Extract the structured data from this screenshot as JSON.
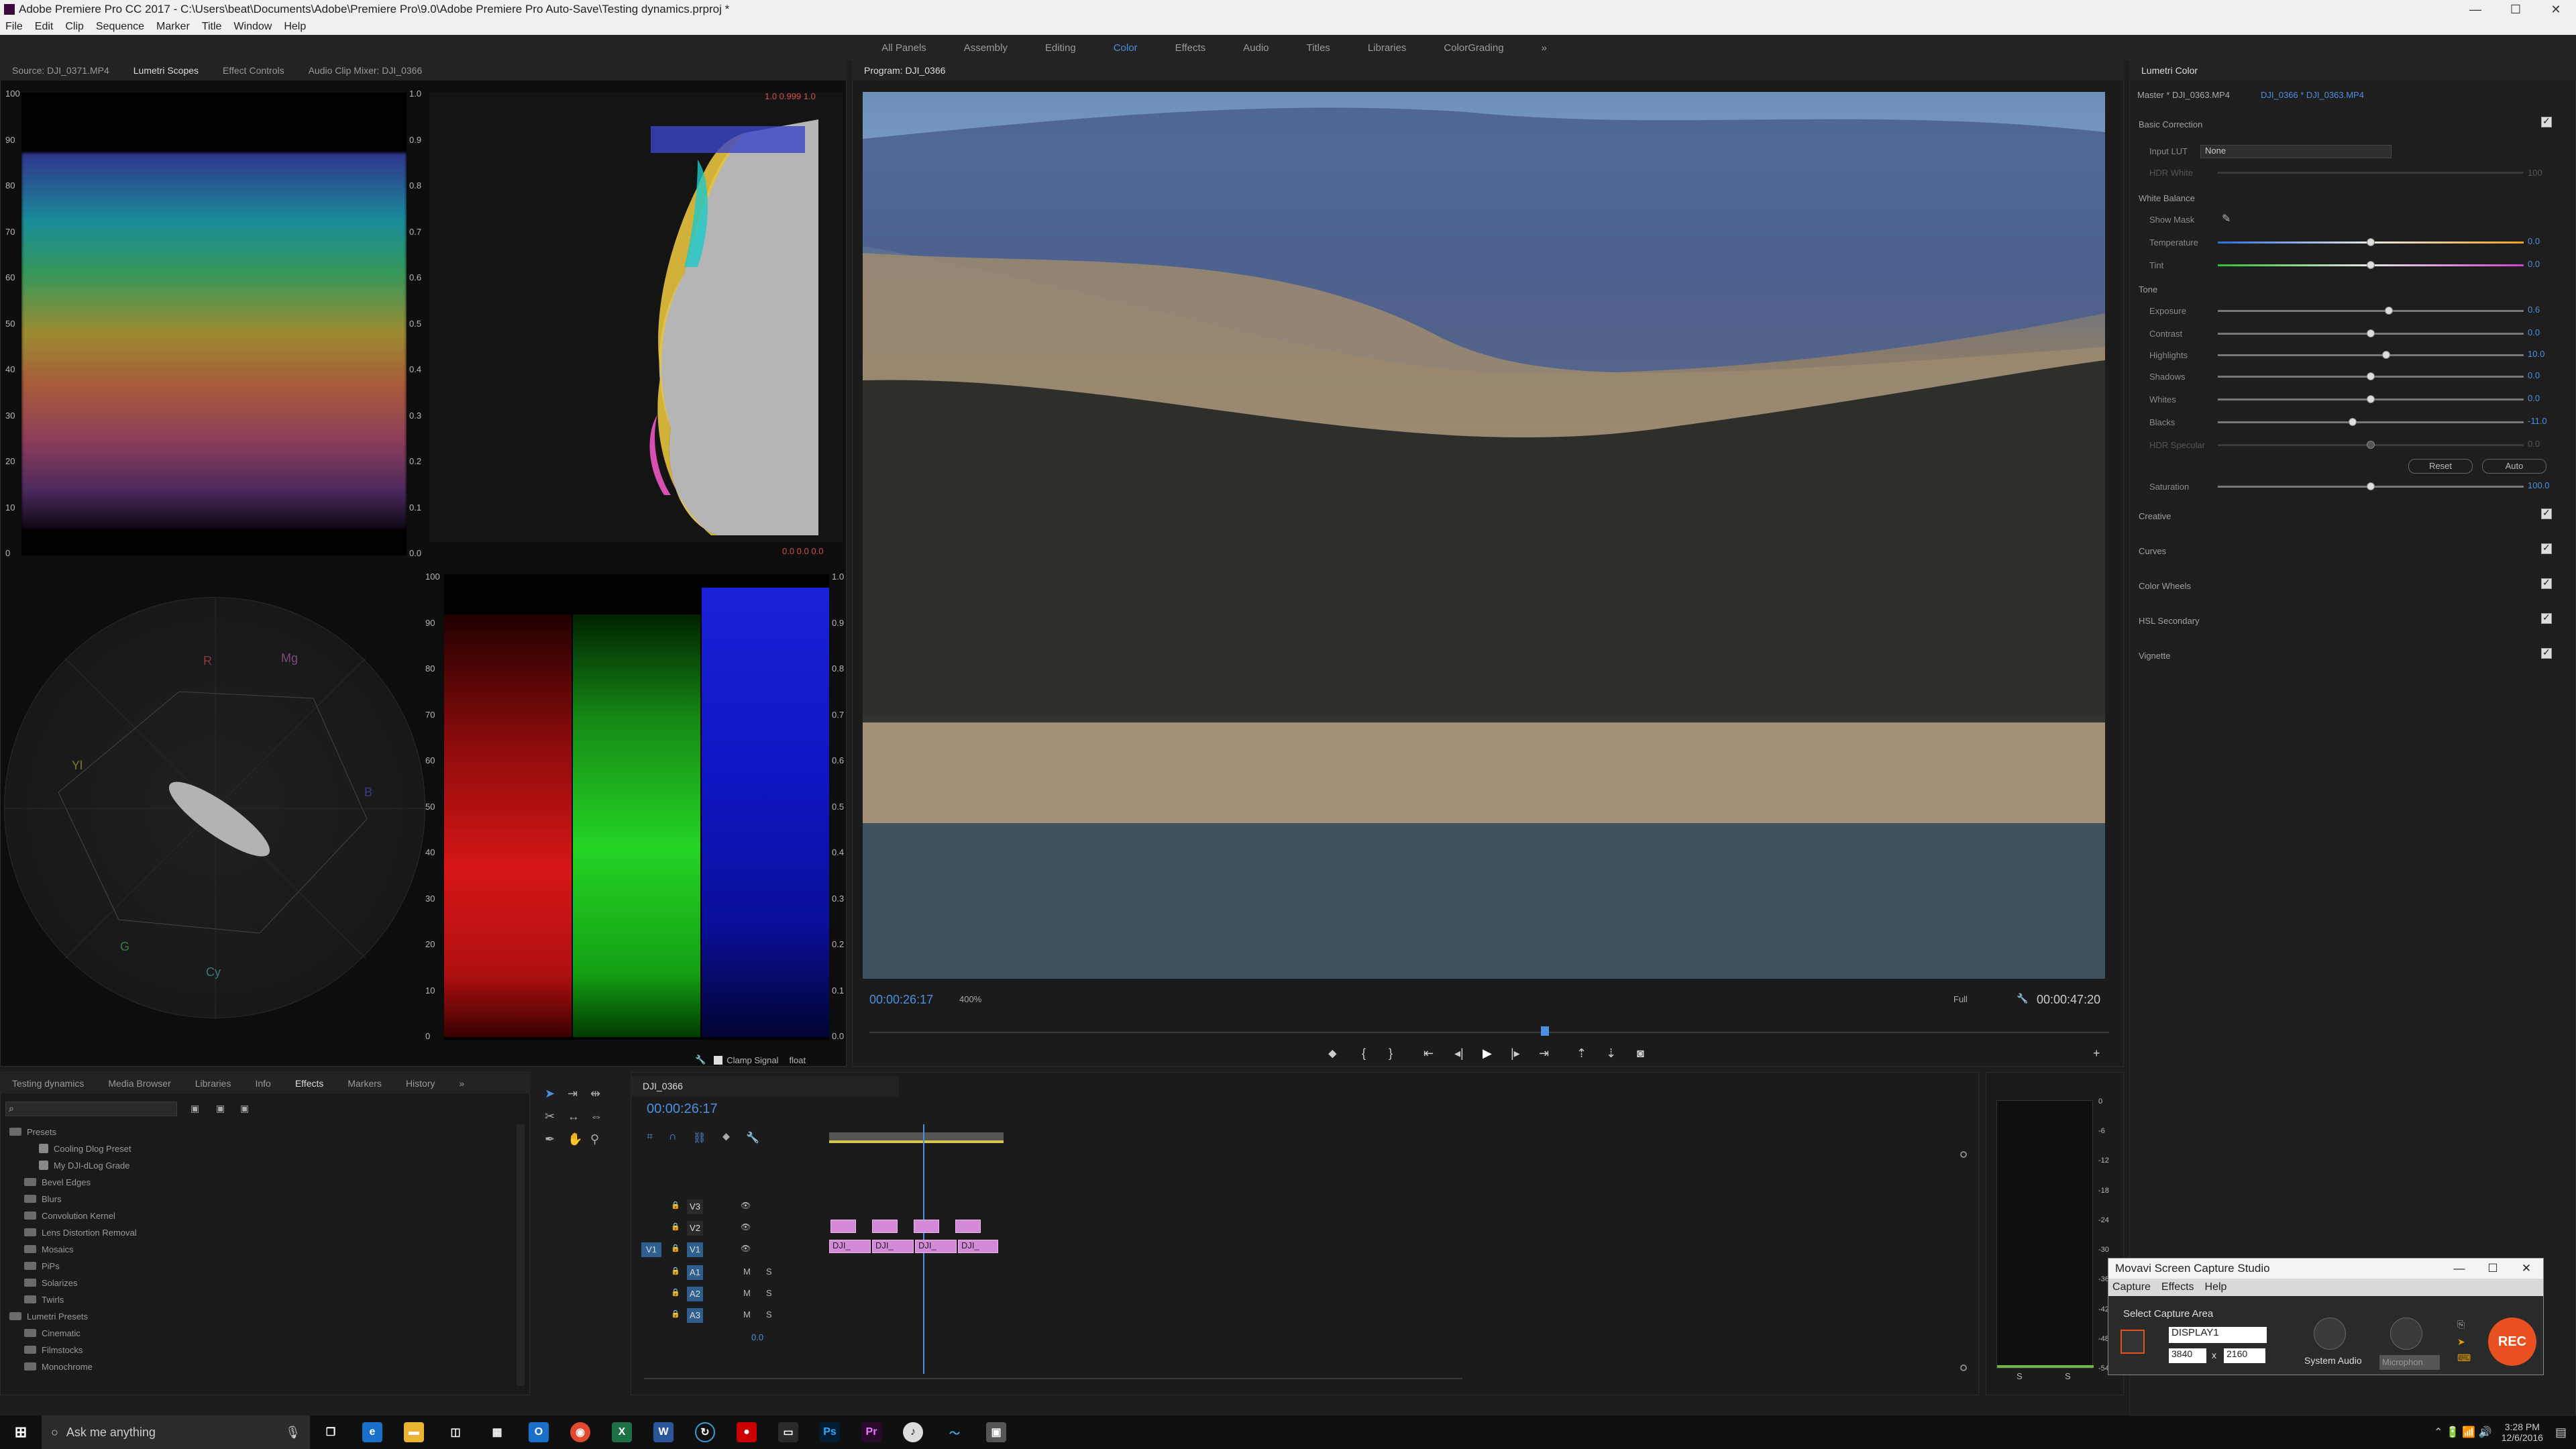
{
  "window": {
    "title": "Adobe Premiere Pro CC 2017 - C:\\Users\\beat\\Documents\\Adobe\\Premiere Pro\\9.0\\Adobe Premiere Pro Auto-Save\\Testing dynamics.prproj *",
    "minimize": "—",
    "maximize": "☐",
    "close": "✕"
  },
  "menu": [
    "File",
    "Edit",
    "Clip",
    "Sequence",
    "Marker",
    "Title",
    "Window",
    "Help"
  ],
  "workspaces": [
    "All Panels",
    "Assembly",
    "Editing",
    "Color",
    "Effects",
    "Audio",
    "Titles",
    "Libraries",
    "ColorGrading"
  ],
  "workspace_more": "»",
  "source_panel": {
    "tabs": [
      "Source: DJI_0371.MP4",
      "Lumetri Scopes",
      "Effect Controls",
      "Audio Clip Mixer: DJI_0366"
    ],
    "active": "Lumetri Scopes",
    "waveform_left_ticks": [
      "100",
      "90",
      "80",
      "70",
      "60",
      "50",
      "40",
      "30",
      "20",
      "10",
      "0"
    ],
    "waveform_right_ticks": [
      "1.0",
      "0.9",
      "0.8",
      "0.7",
      "0.6",
      "0.5",
      "0.4",
      "0.3",
      "0.2",
      "0.1",
      "0.0"
    ],
    "histogram_top_readout": "1.0  0.999  1.0",
    "histogram_bottom_readout": "0.0  0.0  0.0",
    "vectorscope_labels": [
      "R",
      "Mg",
      "B",
      "Cy",
      "G",
      "Yl"
    ],
    "rgb_parade_ticks_left": [
      "100",
      "90",
      "80",
      "70",
      "60",
      "50",
      "40",
      "30",
      "20",
      "10",
      "0"
    ],
    "rgb_parade_ticks_right": [
      "1.0",
      "0.9",
      "0.8",
      "0.7",
      "0.6",
      "0.5",
      "0.4",
      "0.3",
      "0.2",
      "0.1",
      "0.0"
    ],
    "clamp_signal": "Clamp Signal",
    "float_select": "float"
  },
  "program": {
    "title": "Program: DJI_0366",
    "timecode_current": "00:00:26:17",
    "zoom": "400%",
    "quality": "Full",
    "timecode_total": "00:00:47:20",
    "playhead": 0.545
  },
  "lumetri": {
    "title": "Lumetri Color",
    "master": "Master * DJI_0363.MP4",
    "clip": "DJI_0366 * DJI_0363.MP4",
    "basic_correction": "Basic Correction",
    "input_lut_label": "Input LUT",
    "input_lut_value": "None",
    "hdr_white": "HDR White",
    "hdr_white_val": "100",
    "white_balance": "White Balance",
    "show_mask": "Show Mask",
    "sliders": [
      {
        "label": "Temperature",
        "value": "0.0",
        "pos": 0.5
      },
      {
        "label": "Tint",
        "value": "0.0",
        "pos": 0.5
      },
      {
        "label": "Exposure",
        "value": "0.6",
        "pos": 0.56
      },
      {
        "label": "Contrast",
        "value": "0.0",
        "pos": 0.5
      },
      {
        "label": "Highlights",
        "value": "10.0",
        "pos": 0.55
      },
      {
        "label": "Shadows",
        "value": "0.0",
        "pos": 0.5
      },
      {
        "label": "Whites",
        "value": "0.0",
        "pos": 0.5
      },
      {
        "label": "Blacks",
        "value": "-11.0",
        "pos": 0.44
      },
      {
        "label": "HDR Specular",
        "value": "0.0",
        "pos": 0.5
      }
    ],
    "tone": "Tone",
    "reset": "Reset",
    "auto": "Auto",
    "saturation": "Saturation",
    "saturation_value": "100.0",
    "saturation_pos": 0.5,
    "sections": [
      "Creative",
      "Curves",
      "Color Wheels",
      "HSL Secondary",
      "Vignette"
    ]
  },
  "project_panel": {
    "tabs": [
      "Testing dynamics",
      "Media Browser",
      "Libraries",
      "Info",
      "Effects",
      "Markers",
      "History"
    ],
    "active": "Effects",
    "more": "»",
    "tree": [
      {
        "label": "Presets",
        "indent": 0
      },
      {
        "label": "Cooling Dlog Preset",
        "indent": 2
      },
      {
        "label": "My DJI-dLog Grade",
        "indent": 2
      },
      {
        "label": "Bevel Edges",
        "indent": 1
      },
      {
        "label": "Blurs",
        "indent": 1
      },
      {
        "label": "Convolution Kernel",
        "indent": 1
      },
      {
        "label": "Lens Distortion Removal",
        "indent": 1
      },
      {
        "label": "Mosaics",
        "indent": 1
      },
      {
        "label": "PiPs",
        "indent": 1
      },
      {
        "label": "Solarizes",
        "indent": 1
      },
      {
        "label": "Twirls",
        "indent": 1
      },
      {
        "label": "Lumetri Presets",
        "indent": 0
      },
      {
        "label": "Cinematic",
        "indent": 1
      },
      {
        "label": "Filmstocks",
        "indent": 1
      },
      {
        "label": "Monochrome",
        "indent": 1
      }
    ]
  },
  "timeline": {
    "tab": "DJI_0366",
    "timecode": "00:00:26:17",
    "tracks_video": [
      "V3",
      "V2",
      "V1"
    ],
    "tracks_audio": [
      "A1",
      "A2",
      "A3"
    ],
    "source_patch": "V1",
    "master_value": "0.0",
    "clip_labels": [
      "DJI_",
      "DJI_",
      "DJI_",
      "DJI_"
    ],
    "m": "M",
    "s": "S"
  },
  "meter": {
    "ticks": [
      "0",
      "-6",
      "-12",
      "-18",
      "-24",
      "-30",
      "-36",
      "-42",
      "-48",
      "-54"
    ],
    "bottom": [
      "S",
      "S"
    ]
  },
  "movavi": {
    "title": "Movavi Screen Capture Studio",
    "menu": [
      "Capture",
      "Effects",
      "Help"
    ],
    "select_area": "Select Capture Area",
    "display": "DISPLAY1",
    "width": "3840",
    "height": "2160",
    "x": "x",
    "system_audio": "System Audio",
    "microphone": "Microphon",
    "rec": "REC"
  },
  "taskbar": {
    "search": "Ask me anything",
    "time": "3:28 PM",
    "date": "12/6/2016"
  },
  "colors": {
    "accent": "#4d8fe0",
    "clip": "#d58ad9",
    "rec": "#e8501f"
  }
}
